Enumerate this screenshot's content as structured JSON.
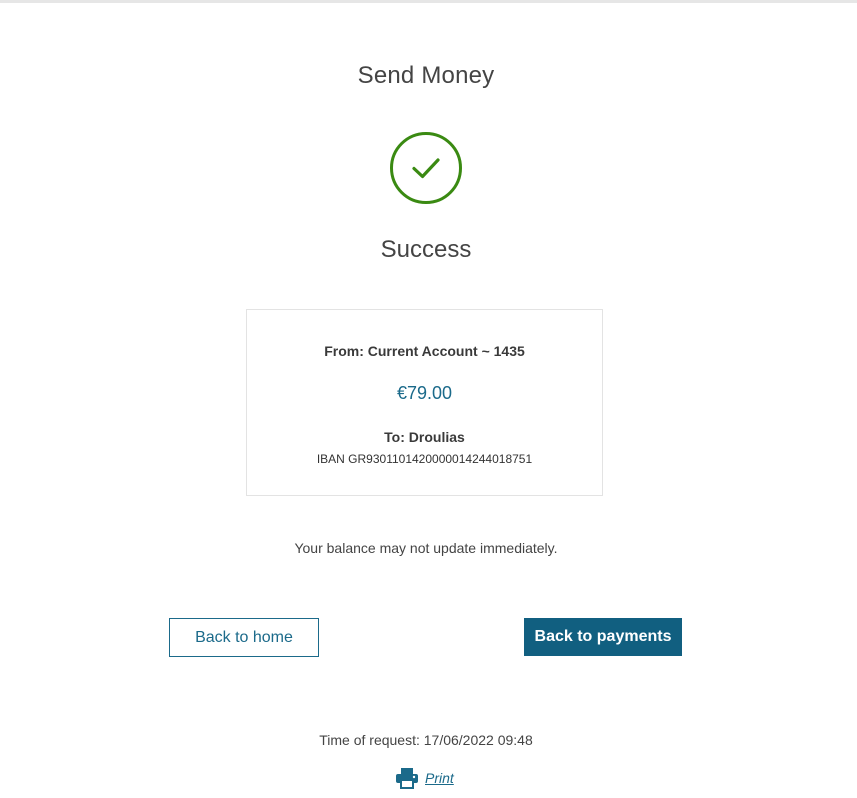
{
  "page": {
    "title": "Send Money",
    "status_heading": "Success",
    "balance_note": "Your balance may not update immediately.",
    "time_of_request": "Time of request: 17/06/2022 09:48"
  },
  "summary": {
    "from": "From: Current Account ~ 1435",
    "amount": "€79.00",
    "to": "To: Droulias",
    "iban": "IBAN GR9301101420000014244018751"
  },
  "actions": {
    "back_to_home": "Back to home",
    "back_to_payments": "Back to payments",
    "print": "Print"
  },
  "icons": {
    "status": "check-circle-icon",
    "print": "printer-icon"
  },
  "colors": {
    "success": "#3a8a12",
    "accent": "#1b6a8a",
    "primary_button": "#115f80"
  }
}
